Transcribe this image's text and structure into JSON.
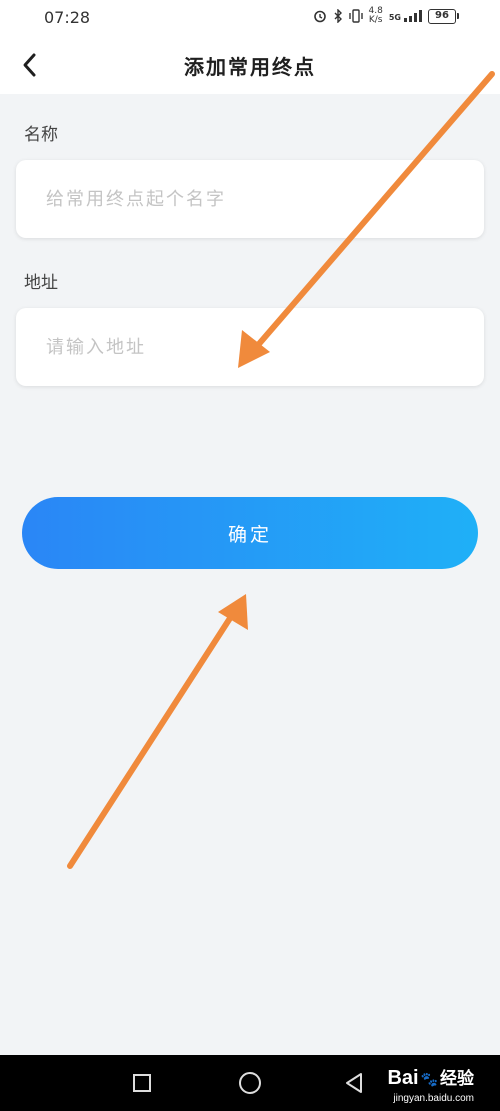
{
  "status_bar": {
    "time": "07:28",
    "net_speed_value": "4.8",
    "net_speed_unit": "K/s",
    "signal_label": "5G",
    "battery": "96"
  },
  "header": {
    "title": "添加常用终点"
  },
  "form": {
    "name_label": "名称",
    "name_placeholder": "给常用终点起个名字",
    "name_value": "",
    "address_label": "地址",
    "address_placeholder": "请输入地址",
    "address_value": ""
  },
  "confirm_button": {
    "label": "确定"
  },
  "watermark": {
    "brand": "Bai",
    "brand_suffix": "经验",
    "url": "jingyan.baidu.com"
  },
  "colors": {
    "button_gradient_start": "#2a86f6",
    "button_gradient_end": "#1fb0f7",
    "annotation_arrow": "#f08a3c",
    "background": "#f2f4f6"
  }
}
